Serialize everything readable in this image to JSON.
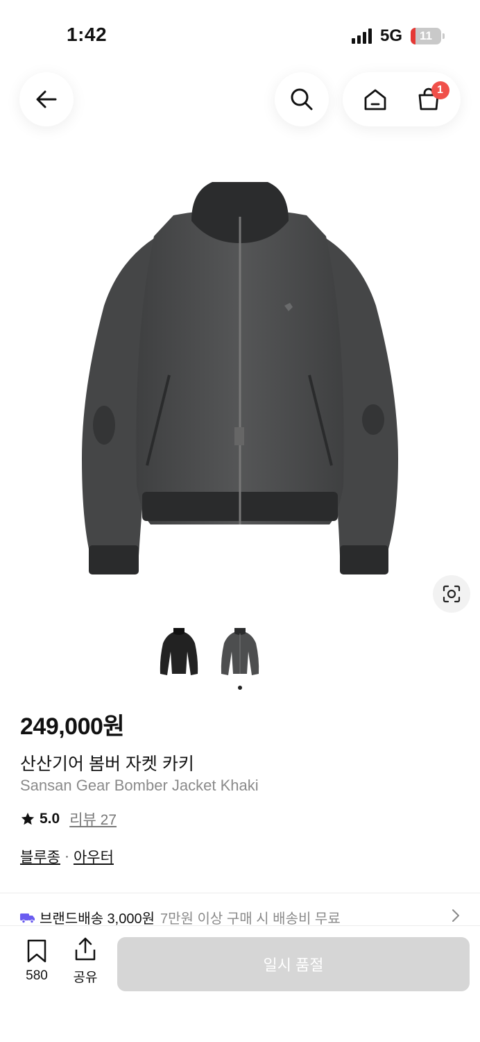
{
  "status_bar": {
    "time": "1:42",
    "network": "5G",
    "battery": "11"
  },
  "header": {
    "cart_count": "1"
  },
  "product": {
    "price": "249,000원",
    "name_ko": "산산기어 봄버 자켓 카키",
    "name_en": "Sansan Gear Bomber Jacket Khaki",
    "rating": "5.0",
    "review_label": "리뷰 27",
    "category_1": "블루종",
    "separator": "·",
    "category_2": "아우터"
  },
  "shipping": {
    "brand": "브랜드배송 3,000원",
    "condition": "7만원 이상 구매 시 배송비 무료"
  },
  "bottom_bar": {
    "bookmark_count": "580",
    "share_label": "공유",
    "buy_label": "일시 품절"
  },
  "icons": [
    "back-arrow-icon",
    "search-icon",
    "home-icon",
    "cart-icon",
    "lens-icon",
    "star-icon",
    "truck-icon",
    "chevron-right-icon",
    "bookmark-icon",
    "share-icon"
  ],
  "colors": {
    "badge": "#f0504a",
    "truck": "#6a5cf0",
    "soldout_bg": "#d6d6d6",
    "jacket": "#4a4b4c"
  }
}
